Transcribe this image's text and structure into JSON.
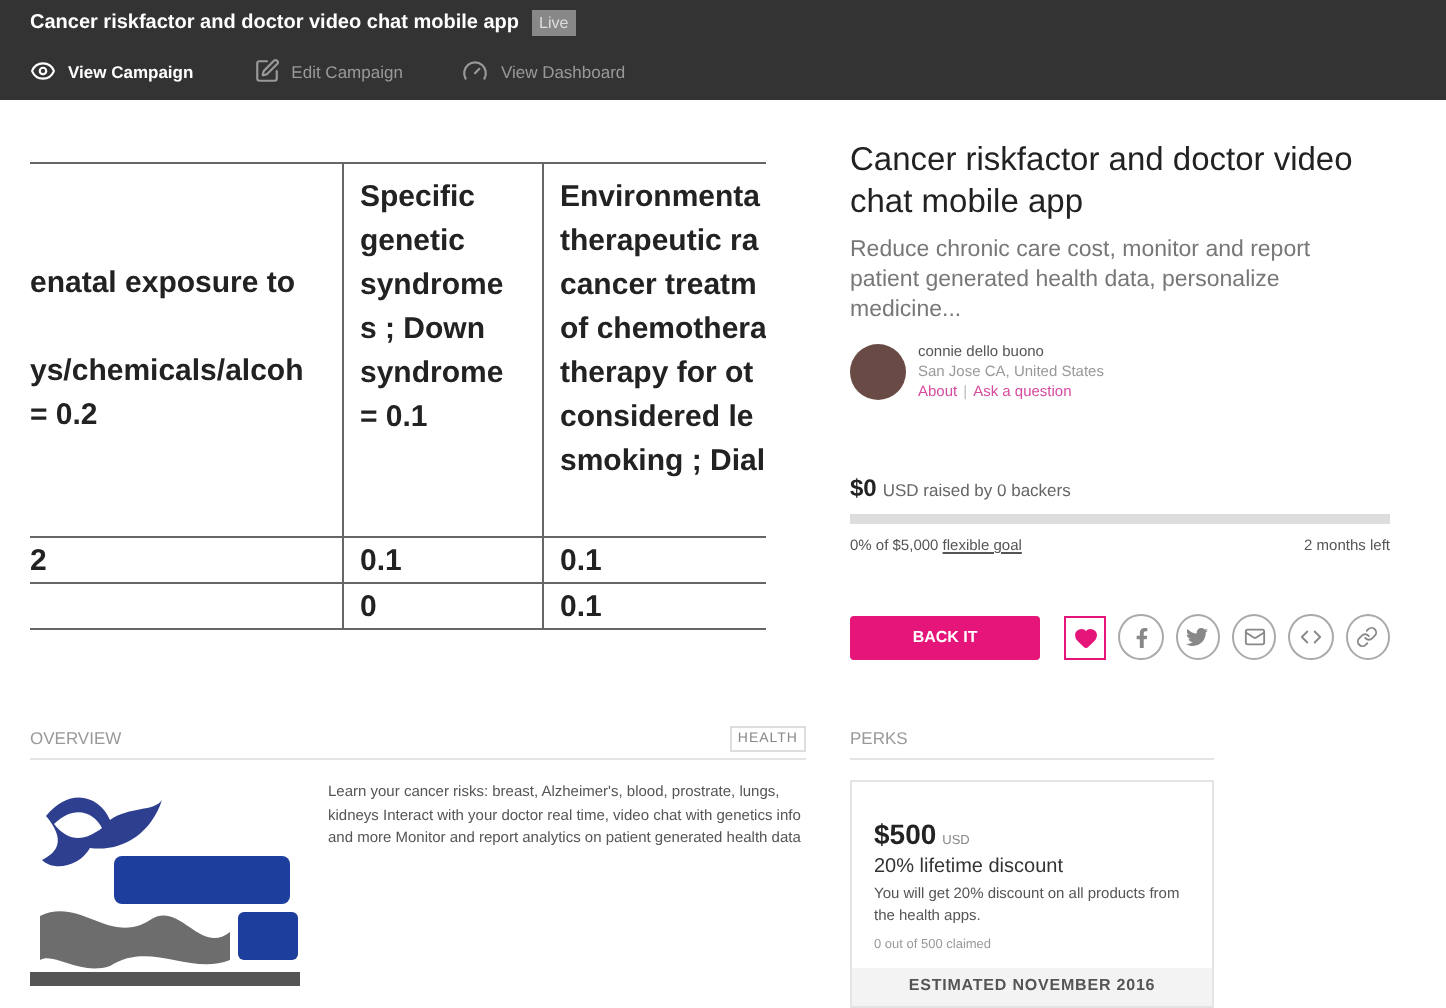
{
  "header": {
    "title": "Cancer riskfactor and doctor video chat mobile app",
    "badge": "Live",
    "nav": [
      {
        "label": "View Campaign",
        "selected": true
      },
      {
        "label": "Edit Campaign",
        "selected": false
      },
      {
        "label": "View Dashboard",
        "selected": false
      }
    ]
  },
  "hero_table": {
    "header": [
      [
        "enatal exposure to",
        "ys/chemicals/alcoh",
        "= 0.2"
      ],
      [
        "Specific",
        "genetic",
        "syndrome",
        "s ; Down",
        "syndrome",
        "= 0.1"
      ],
      [
        "Environmenta",
        "therapeutic ra",
        "cancer treatm",
        "of chemothera",
        "therapy for ot",
        "considered le",
        "smoking ; Dial"
      ]
    ],
    "rows": [
      {
        "column_1": "2",
        "column_2": "0.1",
        "column_3": "0.1"
      },
      {
        "column_2": "0",
        "column_3": "0.1"
      }
    ]
  },
  "campaign": {
    "title": "Cancer riskfactor and doctor video chat mobile app",
    "summary": "Reduce chronic care cost, monitor and report patient generated health data, personalize medicine...",
    "owner": {
      "name": "connie dello buono",
      "location": "San Jose CA, United States",
      "links": [
        "About",
        "Ask a question"
      ],
      "link_separator": "|"
    },
    "raised": "$0",
    "raised_text": "USD raised by 0 backers",
    "level": 0,
    "goal_text": "0% of $5,000",
    "goal_link": "flexible goal",
    "time_left": "2 months left",
    "back_button": "BACK IT",
    "liked": true
  },
  "overview": {
    "heading": "OVERVIEW",
    "tag": "HEALTH",
    "description": "Learn your cancer risks: breast, Alzheimer's, blood, prostrate, lungs, kidneys Interact with your doctor real time, video chat with genetics info and more Monitor and report analytics on patient generated health data"
  },
  "perks": {
    "heading": "PERKS",
    "items": [
      {
        "price": "$500",
        "currency": "USD",
        "title": "20% lifetime discount",
        "description": "You will get 20% discount on all products from the health apps.",
        "claimed": "0 out of 500 claimed",
        "estimate": "ESTIMATED NOVEMBER 2016"
      }
    ]
  }
}
